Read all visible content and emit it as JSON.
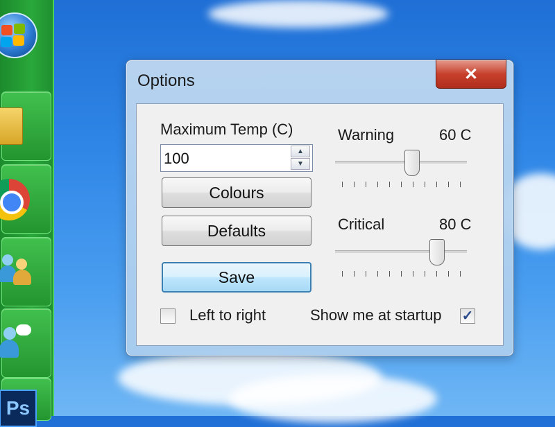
{
  "window": {
    "title": "Options",
    "close_glyph": "✕"
  },
  "max_temp": {
    "label": "Maximum Temp (C)",
    "value": "100"
  },
  "buttons": {
    "colours": "Colours",
    "defaults": "Defaults",
    "save": "Save"
  },
  "warning": {
    "label": "Warning",
    "value_text": "60 C",
    "level": 0.58
  },
  "critical": {
    "label": "Critical",
    "value_text": "80 C",
    "level": 0.77
  },
  "checkboxes": {
    "left_to_right": {
      "label": "Left to right",
      "checked": false
    },
    "show_at_startup": {
      "label": "Show me at startup",
      "checked": true
    }
  },
  "taskbar": {
    "ps_label": "Ps"
  },
  "colors": {
    "accent": "#3c7fb1",
    "close": "#c7402c",
    "taskbar": "#24952f"
  }
}
